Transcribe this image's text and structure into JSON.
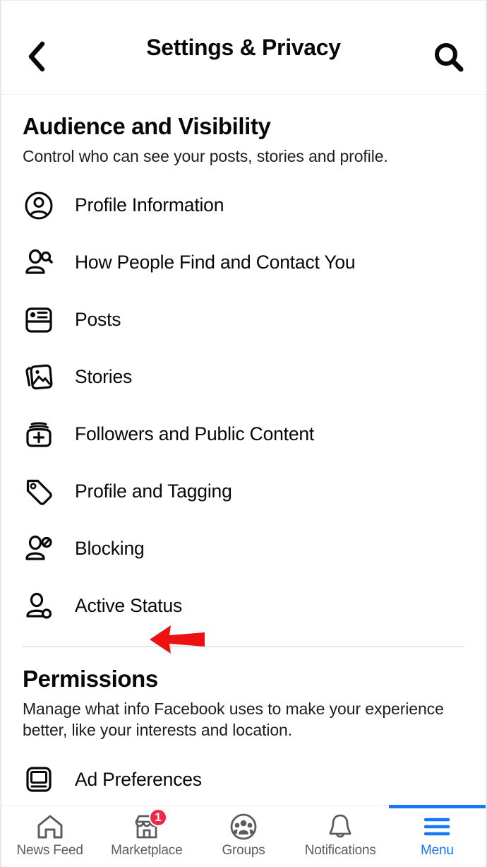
{
  "topbar": {
    "back_icon": "chevron-left-icon",
    "title": "Settings & Privacy",
    "search_icon": "search-icon"
  },
  "sections": [
    {
      "id": "audience-and-visibility",
      "title": "Audience and Visibility",
      "description": "Control who can see your posts, stories and profile.",
      "items": [
        {
          "label": "Profile Information",
          "icon": "profile-circle-icon"
        },
        {
          "label": "How People Find and Contact You",
          "icon": "person-search-icon"
        },
        {
          "label": "Posts",
          "icon": "post-card-icon"
        },
        {
          "label": "Stories",
          "icon": "stories-photo-icon"
        },
        {
          "label": "Followers and Public Content",
          "icon": "box-plus-icon"
        },
        {
          "label": "Profile and Tagging",
          "icon": "tag-icon"
        },
        {
          "label": "Blocking",
          "icon": "person-block-icon",
          "annotated": true
        },
        {
          "label": "Active Status",
          "icon": "person-status-icon"
        }
      ]
    },
    {
      "id": "permissions",
      "title": "Permissions",
      "description": "Manage what info Facebook uses to make your experience better, like your interests and location.",
      "items": [
        {
          "label": "Ad Preferences",
          "icon": "monitor-icon"
        }
      ]
    }
  ],
  "annotation": {
    "type": "arrow-left",
    "color": "#ee1111",
    "points_to": "Blocking"
  },
  "tabbar": {
    "active": "Menu",
    "tabs": [
      {
        "label": "News Feed",
        "icon": "home-icon",
        "badge": ""
      },
      {
        "label": "Marketplace",
        "icon": "store-icon",
        "badge": "1"
      },
      {
        "label": "Groups",
        "icon": "groups-icon",
        "badge": ""
      },
      {
        "label": "Notifications",
        "icon": "bell-icon",
        "badge": ""
      },
      {
        "label": "Menu",
        "icon": "hamburger-icon",
        "badge": ""
      }
    ]
  },
  "colors": {
    "accent_blue": "#1877f2",
    "badge_red": "#f02849",
    "annotation_red": "#ee1111",
    "text_primary": "#080809",
    "text_muted": "#5a5c60"
  }
}
